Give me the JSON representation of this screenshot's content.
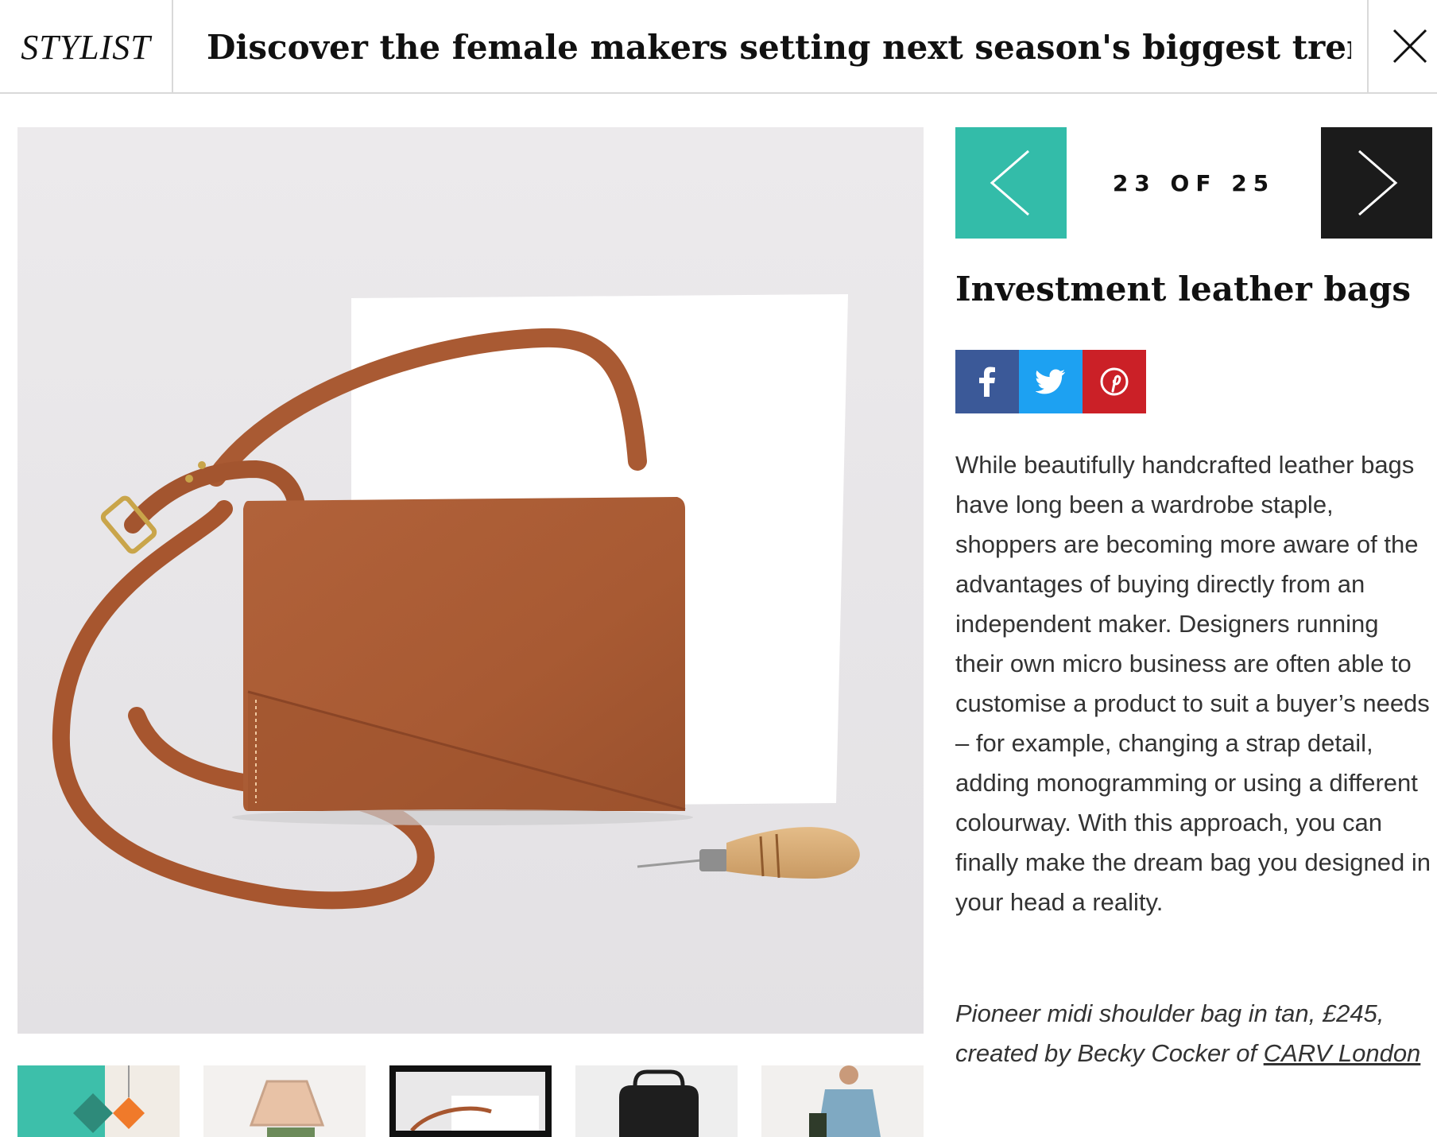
{
  "header": {
    "logo": "STYLIST",
    "title": "Discover the female makers setting next season's biggest trends",
    "close_icon": "close-icon"
  },
  "gallery": {
    "counter": "23 OF 25",
    "current": 23,
    "total": 25,
    "prev_icon": "chevron-left-icon",
    "next_icon": "chevron-right-icon",
    "accent_color": "#33bca9",
    "next_color": "#1b1b1b"
  },
  "slide": {
    "title": "Investment leather bags",
    "body": "While beautifully handcrafted leather bags have long been a wardrobe staple, shoppers are becoming more aware of the advantages of buying directly from an independent maker. Designers running their own micro business are often able to customise a product to suit a buyer’s needs – for example, changing a strap detail, adding monogramming or using a different colourway. With this approach, you can finally make the dream bag you designed in your head a reality.",
    "caption_prefix": "Pioneer midi shoulder bag in tan, £245, created by Becky Cocker of ",
    "caption_link": "CARV London"
  },
  "share": {
    "buttons": [
      {
        "name": "facebook",
        "icon": "facebook-icon",
        "color": "#3b5998"
      },
      {
        "name": "twitter",
        "icon": "twitter-icon",
        "color": "#1da1f2"
      },
      {
        "name": "pinterest",
        "icon": "pinterest-icon",
        "color": "#cb2027"
      }
    ]
  },
  "thumbnails": [
    {
      "subject": "teal tile with hanging ornaments",
      "active": false
    },
    {
      "subject": "copper hexagon mirror",
      "active": false
    },
    {
      "subject": "tan leather shoulder bag",
      "active": true
    },
    {
      "subject": "black leather backpack",
      "active": false
    },
    {
      "subject": "woman in blue dress",
      "active": false
    }
  ]
}
